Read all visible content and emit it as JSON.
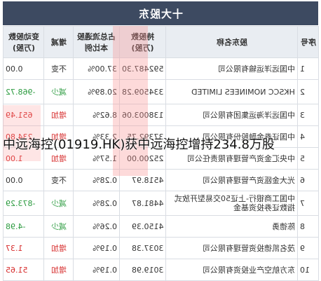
{
  "title": "十大股东",
  "headers": {
    "change": "变动股数\n(万股)",
    "direction": "增减",
    "pct": "占总流通股本比例",
    "shares": "持股数\n(万股)",
    "name": "股东名称",
    "idx": "序号"
  },
  "rows": [
    {
      "idx": "1",
      "name": "中国远洋运输有限公司",
      "shares": "592487.30",
      "pct": "37.00%",
      "dir": "不变",
      "change": "0.00",
      "dir_type": "flat"
    },
    {
      "idx": "2",
      "name": "HKSCC NOMINEES LIMITED",
      "shares": "334509.28",
      "pct": "20.89%",
      "dir": "减少",
      "change": "-968.72",
      "dir_type": "down"
    },
    {
      "idx": "3",
      "name": "中国远洋海运集团有限公司",
      "shares": "138003.06",
      "pct": "8.62%",
      "dir": "增加",
      "change": "651.49",
      "dir_type": "up"
    },
    {
      "idx": "4",
      "name": "中国证券金融股份有限公司",
      "shares": "37392.75",
      "pct": "2.33%",
      "dir": "增加",
      "change": "234.80",
      "dir_type": "up"
    },
    {
      "idx": "5",
      "name": "中央汇金资产管理有限责任公司",
      "shares": "25200.00",
      "pct": "1.57%",
      "dir": "增加",
      "change": "1.00",
      "dir_type": "up"
    },
    {
      "idx": "6",
      "name": "光大金瓯资产管理有限公司",
      "shares": "4518.97",
      "pct": "0.28%",
      "dir": "不变",
      "change": "0.00",
      "dir_type": "flat"
    },
    {
      "idx": "7",
      "name": "中国工商银行-上证50交易型开放式指数证券投资基金",
      "shares": "4481.87",
      "pct": "0.28%",
      "dir": "减少",
      "change": "-873.29",
      "dir_type": "down"
    },
    {
      "idx": "8",
      "name": "陈德勇",
      "shares": "4150.39",
      "pct": "0.26%",
      "dir": "减少",
      "change": "-4.98",
      "dir_type": "down"
    },
    {
      "idx": "9",
      "name": "茂名凯德投资管理有限公司",
      "shares": "3037.38",
      "pct": "0.19%",
      "dir": "增加",
      "change": "1.37",
      "dir_type": "up"
    },
    {
      "idx": "10",
      "name": "东方航空产业投资有限公司",
      "shares": "3019.98",
      "pct": "0.19%",
      "dir": "增加",
      "change": "51.65",
      "dir_type": "up"
    }
  ],
  "caption": "中远海控(01919.HK)获中远海控增持234.8万股",
  "colors": {
    "header_bar": "#3d4a61",
    "up": "#d62a2a",
    "down": "#2a9a3e"
  }
}
